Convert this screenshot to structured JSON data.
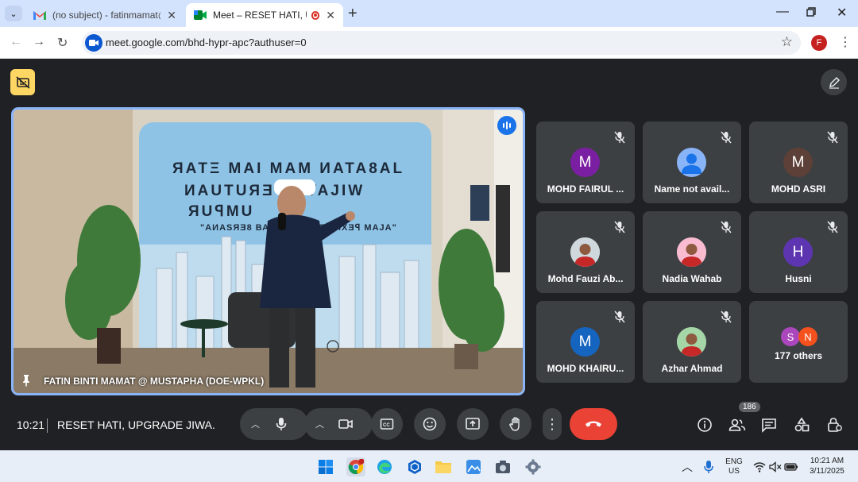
{
  "browser": {
    "tabs": [
      {
        "title": "(no subject) - fatinmamat@doe",
        "icon": "gmail-icon",
        "active": false
      },
      {
        "title": "Meet – RESET HATI, UPGRADE JIWA.",
        "icon": "meet-icon",
        "active": true
      }
    ],
    "url": "meet.google.com/bhd-hypr-apc?authuser=0",
    "profile_initial": "F"
  },
  "meet": {
    "stage_name": "FATIN BINTI MAMAT @ MUSTAPHA (DOE-WPKL)",
    "participants": [
      {
        "name": "MOHD FAIRUL ...",
        "initial": "M",
        "color": "#7b1fa2",
        "avatar": "letter",
        "muted": true
      },
      {
        "name": "Name not avail...",
        "initial": "",
        "color": "#8ab4f8",
        "avatar": "default",
        "muted": true
      },
      {
        "name": "MOHD ASRI",
        "initial": "M",
        "color": "#5d4037",
        "avatar": "letter",
        "muted": true
      },
      {
        "name": "Mohd Fauzi Ab...",
        "initial": "",
        "color": "#cfd8dc",
        "avatar": "photo",
        "muted": true
      },
      {
        "name": "Nadia Wahab",
        "initial": "",
        "color": "#f8bbd0",
        "avatar": "photo",
        "muted": true
      },
      {
        "name": "Husni",
        "initial": "H",
        "color": "#5e35b1",
        "avatar": "letter",
        "muted": true
      },
      {
        "name": "MOHD KHAIRU...",
        "initial": "M",
        "color": "#1565c0",
        "avatar": "letter",
        "muted": true
      },
      {
        "name": "Azhar Ahmad",
        "initial": "",
        "color": "#a5d6a7",
        "avatar": "photo",
        "muted": true
      }
    ],
    "others": {
      "label": "177 others",
      "initials": [
        "S",
        "N"
      ],
      "colors": [
        "#ab47bc",
        "#f4511e"
      ]
    },
    "time": "10:21",
    "meeting_name": "RESET HATI, UPGRADE JIWA.",
    "people_count": "186"
  },
  "taskbar": {
    "lang": "ENG",
    "region": "US",
    "time": "10:21 AM",
    "date": "3/11/2025"
  }
}
